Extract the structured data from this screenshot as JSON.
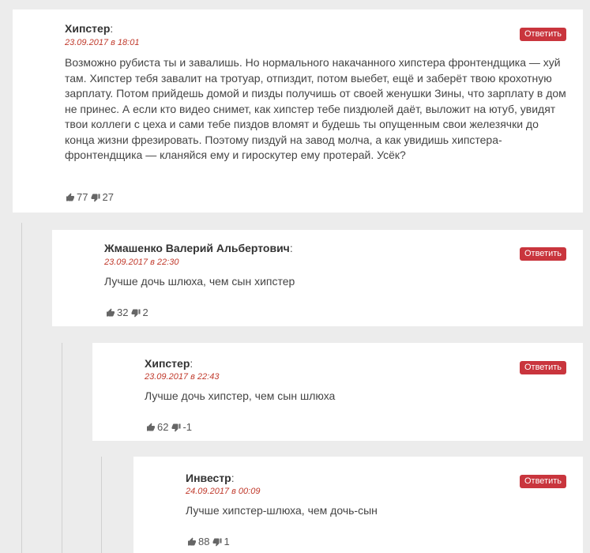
{
  "comments": [
    {
      "author": "Хипстер",
      "date": "23.09.2017 в 18:01",
      "reply_label": "Ответить",
      "text": "Возможно рубиста ты и завалишь. Но нормального накачанного хипстера фронтендщика — хуй там. Хипстер тебя завалит на тротуар, отпиздит, потом выебет, ещё и заберёт твою крохотную зарплату. Потом прийдешь домой и пизды получишь от своей женушки Зины, что зарплату в дом не принес. А если кто видео снимет, как хипстер тебе пиздюлей даёт, выложит на ютуб, увидят твои коллеги с цеха и сами тебе пиздов вломят и будешь ты опущенным свои железячки до конца жизни фрезировать. Поэтому пиздуй на завод молча, а как увидишь хипстера-фронтендщика — кланяйся ему и гироскутер ему протерай. Усёк?",
      "likes": "77",
      "dislikes": "27"
    },
    {
      "author": "Жмашенко Валерий Альбертович",
      "date": "23.09.2017 в 22:30",
      "reply_label": "Ответить",
      "text": "Лучше дочь шлюха, чем сын хипстер",
      "likes": "32",
      "dislikes": "2"
    },
    {
      "author": "Хипстер",
      "date": "23.09.2017 в 22:43",
      "reply_label": "Ответить",
      "text": "Лучше дочь хипстер, чем сын шлюха",
      "likes": "62",
      "dislikes": "-1"
    },
    {
      "author": "Инвестр",
      "date": "24.09.2017 в 00:09",
      "reply_label": "Ответить",
      "text": "Лучше хипстер-шлюха, чем дочь-сын",
      "likes": "88",
      "dislikes": "1"
    }
  ],
  "colors": {
    "page_bg": "#ececec",
    "card_bg": "#ffffff",
    "accent": "#c9353d",
    "date": "#c0392b"
  },
  "icons": {
    "like": "thumbs-up-icon",
    "dislike": "thumbs-down-icon"
  }
}
